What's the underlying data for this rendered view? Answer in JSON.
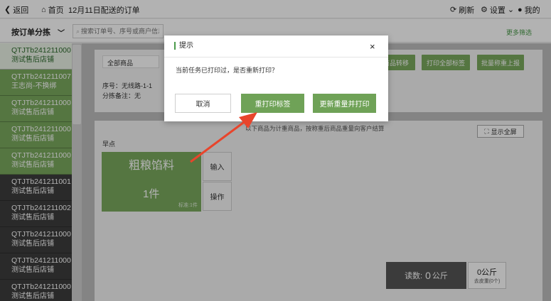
{
  "topbar": {
    "back": "返回",
    "home": "首页",
    "title": "12月11日配送的订单",
    "refresh": "刷新",
    "settings": "设置",
    "user": "我的"
  },
  "subbar": {
    "sort": "按订单分拣",
    "search_placeholder": "搜索订单号、序号或商户信息",
    "more_filter": "更多筛选"
  },
  "orders": [
    {
      "id": "QTJTb241211000",
      "store": "测试售后店铺"
    },
    {
      "id": "QTJTb241211007",
      "store": "王志尚-不换绑"
    },
    {
      "id": "QTJTb241211000",
      "store": "测试售后店铺"
    },
    {
      "id": "QTJTb241211000",
      "store": "测试售后店铺"
    },
    {
      "id": "QTJTb241211000",
      "store": "测试售后店铺"
    },
    {
      "id": "QTJTb241211001",
      "store": "测试售后店铺"
    },
    {
      "id": "QTJTb241211002",
      "store": "测试售后店铺"
    },
    {
      "id": "QTJTb241211000",
      "store": "测试售后店铺"
    },
    {
      "id": "QTJTb241211000",
      "store": "测试售后店铺"
    },
    {
      "id": "QTJTb241211000",
      "store": "测试售后店铺"
    }
  ],
  "panel": {
    "goods_filter": "全部商品",
    "btn_transfer": "商品转移",
    "btn_print_all": "打印全部标签",
    "btn_batch_report": "批量称重上报",
    "seq": "序号：无线路-1-1",
    "note": "分拣备注：无"
  },
  "weigh": {
    "note": "以下商品为计重商品，按称重后商品重量向客户结算",
    "fullscreen": "显示全屏",
    "category": "早点"
  },
  "product": {
    "name": "粗粮馅料",
    "qty": "1件",
    "std": "标准:1件",
    "btn_input": "输入",
    "btn_operate": "操作"
  },
  "summary": {
    "count_label": "读数:",
    "count_value": "0",
    "count_unit": "公斤",
    "weight": "0公斤",
    "zero": "去皮重(0个)"
  },
  "modal": {
    "title": "提示",
    "close": "×",
    "message": "当前任务已打印过，是否重新打印？",
    "cancel": "取消",
    "reprint": "重打印标签",
    "update_print": "更新重量并打印"
  },
  "colors": {
    "green": "#7aaa5e",
    "arrow": "#e8452c"
  }
}
